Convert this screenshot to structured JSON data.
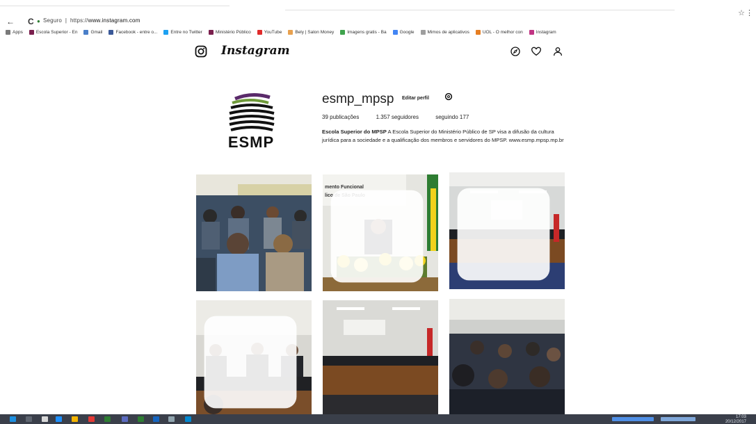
{
  "browser": {
    "url_prefix": "https://",
    "url": "www.instagram.com",
    "security_label": "Seguro"
  },
  "bookmarks": [
    {
      "label": "Apps",
      "color": "#7a7a7a"
    },
    {
      "label": "Escola Superior - En",
      "color": "#7a1f4d"
    },
    {
      "label": "Gmail",
      "color": "#4a7fc9"
    },
    {
      "label": "Facebook - entre o...",
      "color": "#3b5998"
    },
    {
      "label": "Entre no Twitter",
      "color": "#1da1f2"
    },
    {
      "label": "Ministério Público",
      "color": "#7a1f4d"
    },
    {
      "label": "YouTube",
      "color": "#e02b2b"
    },
    {
      "label": "Bely | Salon Money",
      "color": "#e8a14f"
    },
    {
      "label": "Imagens gratis - Ba",
      "color": "#3fa34d"
    },
    {
      "label": "Google",
      "color": "#4285f4"
    },
    {
      "label": "Mimos de aplicativos",
      "color": "#9e9e9e"
    },
    {
      "label": "UOL - O melhor con",
      "color": "#e67e22"
    },
    {
      "label": "Instagram",
      "color": "#c13584"
    }
  ],
  "header": {
    "wordmark": "Instagram",
    "icons": [
      "instagram-logo-icon",
      "explore-icon",
      "heart-icon",
      "user-icon"
    ]
  },
  "profile": {
    "avatar_text": "ESMP",
    "username": "esmp_mpsp",
    "edit_label": "Editar perfil",
    "stats": {
      "posts": "39 publicações",
      "followers": "1.357 seguidores",
      "following": "seguindo 177"
    },
    "bio_name": "Escola Superior do MPSP",
    "bio_text": "A Escola Superior do Ministério Público de SP visa a difusão da cultura jurídica para a sociedade e a qualificação dos membros e servidores do MPSP.",
    "bio_link": "www.esmp.mpsp.mp.br"
  },
  "posts": [
    {
      "scene": "audience",
      "multi": false
    },
    {
      "scene": "speaker",
      "multi": true,
      "caption": "mento Funcional / lico de São Paulo"
    },
    {
      "scene": "panel-wide",
      "multi": true
    },
    {
      "scene": "panel-close",
      "multi": true
    },
    {
      "scene": "panel-room",
      "multi": false
    },
    {
      "scene": "audience-wide",
      "multi": false
    }
  ],
  "taskbar": {
    "time": "17:03",
    "date": "20/12/2017"
  }
}
